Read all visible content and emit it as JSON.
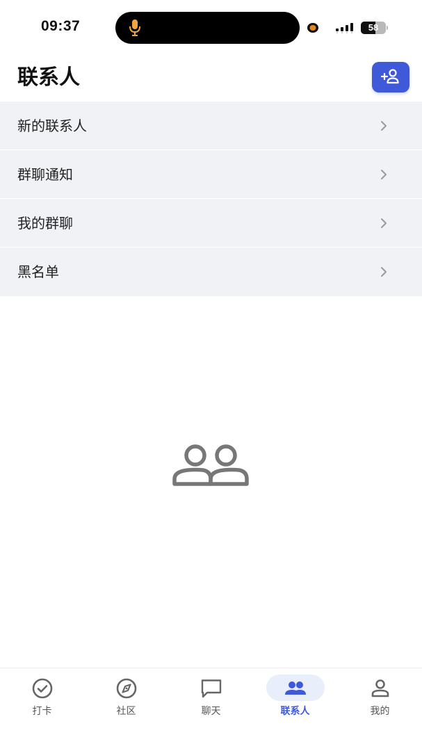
{
  "status_bar": {
    "time": "09:37",
    "battery_level": "58",
    "battery_fraction": 0.58
  },
  "header": {
    "title": "联系人",
    "add_button_icon": "add-person-icon"
  },
  "menu": {
    "items": [
      {
        "label": "新的联系人",
        "icon": "chevron-right-icon"
      },
      {
        "label": "群聊通知",
        "icon": "chevron-right-icon"
      },
      {
        "label": "我的群聊",
        "icon": "chevron-right-icon"
      },
      {
        "label": "黑名单",
        "icon": "chevron-right-icon"
      }
    ]
  },
  "empty_state": {
    "icon": "people-outline-icon"
  },
  "bottom_nav": {
    "items": [
      {
        "label": "打卡",
        "icon": "check-circle-icon",
        "active": false
      },
      {
        "label": "社区",
        "icon": "compass-icon",
        "active": false
      },
      {
        "label": "聊天",
        "icon": "chat-bubble-icon",
        "active": false
      },
      {
        "label": "联系人",
        "icon": "people-icon",
        "active": true
      },
      {
        "label": "我的",
        "icon": "person-icon",
        "active": false
      }
    ]
  },
  "colors": {
    "accent": "#3f59d9",
    "list_background": "#f1f2f6",
    "nav_active_pill": "#e9eefb",
    "recording_dot": "#e8851f",
    "mic": "#f0a640"
  }
}
